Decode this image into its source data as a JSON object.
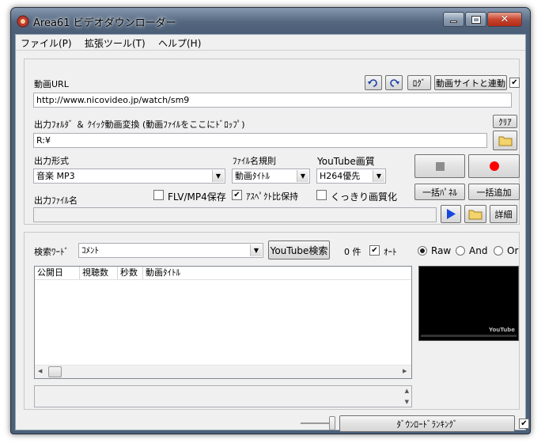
{
  "window": {
    "title": "Area61 ビデオダウンローダー"
  },
  "menu": {
    "file": "ファイル(P)",
    "tools": "拡張ツール(T)",
    "help": "ヘルプ(H)"
  },
  "url_section": {
    "label": "動画URL",
    "value": "http://www.nicovideo.jp/watch/sm9",
    "log_button": "ﾛｸﾞ",
    "link_button": "動画サイトと連動",
    "link_checked": true
  },
  "output_folder": {
    "label": "出力ﾌｫﾙﾀﾞ ＆ ｸｲｯｸ動画変換 (動画ﾌｧｲﾙをここにﾄﾞﾛｯﾌﾟ)",
    "value": "R:¥",
    "clear_button": "ｸﾘｱ"
  },
  "format": {
    "label": "出力形式",
    "value": "音楽 MP3"
  },
  "filename_rule": {
    "label": "ﾌｧｲﾙ名規則",
    "value": "動画ﾀｲﾄﾙ"
  },
  "youtube_quality": {
    "label": "YouTube画質",
    "value": "H264優先"
  },
  "options": {
    "flv_label": "FLV/MP4保存",
    "flv_checked": false,
    "aspect_label": "ｱｽﾍﾟｸﾄ比保持",
    "aspect_checked": true,
    "sharp_label": "くっきり画質化",
    "sharp_checked": false
  },
  "output_filename": {
    "label": "出力ﾌｧｲﾙ名",
    "value": ""
  },
  "buttons": {
    "bulk_panel": "一括ﾊﾟﾈﾙ",
    "bulk_add": "一括追加",
    "details": "詳細"
  },
  "search": {
    "label": "検索ﾜｰﾄﾞ",
    "value": "ｺﾒﾝﾄ",
    "button": "YouTube検索",
    "count": "0 件",
    "auto_label": "ｵｰﾄ",
    "auto_checked": true,
    "radio_raw": "Raw",
    "radio_and": "And",
    "radio_or": "Or",
    "selected_mode": "Raw"
  },
  "results_table": {
    "columns": [
      "公開日",
      "視聴数",
      "秒数",
      "動画ﾀｲﾄﾙ"
    ]
  },
  "preview": {
    "watermark": "YouTube"
  },
  "footer": {
    "ranking_button": "ﾀﾞｳﾝﾛｰﾄﾞﾗﾝｷﾝｸﾞ",
    "ranking_checked": true
  },
  "colors": {
    "play_blue": "#1646e0",
    "record_red": "#ff0000",
    "folder_yellow": "#f3d36b"
  }
}
